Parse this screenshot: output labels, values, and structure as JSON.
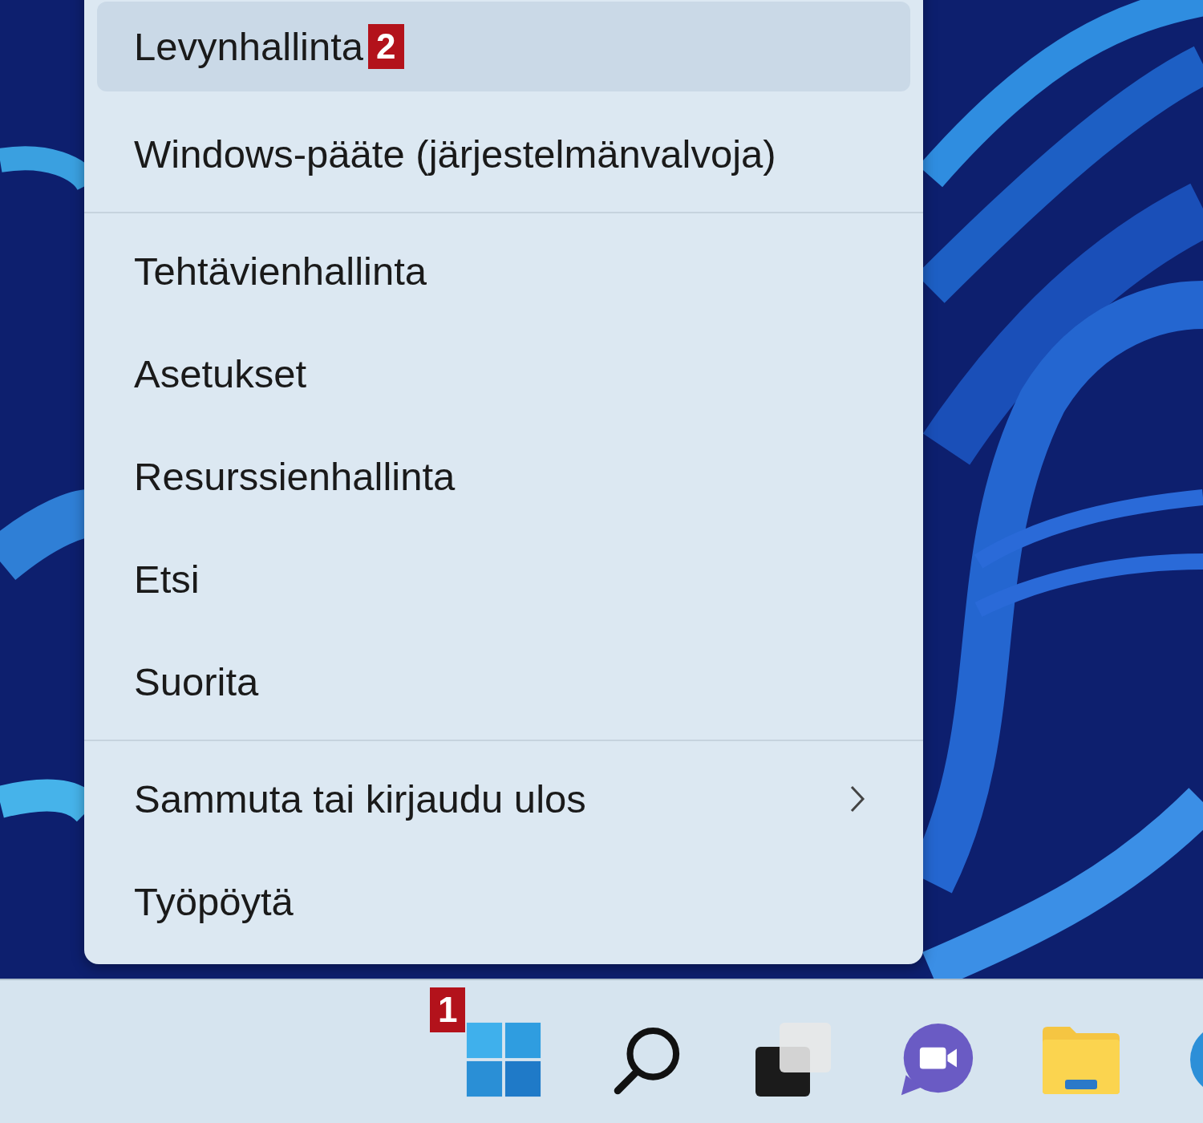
{
  "menu": {
    "groups": [
      [
        {
          "label": "Levynhallinta",
          "badge": "2",
          "selected": true,
          "submenu": false
        },
        {
          "label": "Windows-pääte (järjestelmänvalvoja)",
          "selected": false,
          "submenu": false
        }
      ],
      [
        {
          "label": "Tehtävienhallinta",
          "selected": false,
          "submenu": false
        },
        {
          "label": "Asetukset",
          "selected": false,
          "submenu": false
        },
        {
          "label": "Resurssienhallinta",
          "selected": false,
          "submenu": false
        },
        {
          "label": "Etsi",
          "selected": false,
          "submenu": false
        },
        {
          "label": "Suorita",
          "selected": false,
          "submenu": false
        }
      ],
      [
        {
          "label": "Sammuta tai kirjaudu ulos",
          "selected": false,
          "submenu": true
        },
        {
          "label": "Työpöytä",
          "selected": false,
          "submenu": false
        }
      ]
    ]
  },
  "taskbar": {
    "items": [
      {
        "kind": "start",
        "badge": "1"
      },
      {
        "kind": "search"
      },
      {
        "kind": "task-view"
      },
      {
        "kind": "chat"
      },
      {
        "kind": "explorer"
      },
      {
        "kind": "browser"
      }
    ]
  }
}
